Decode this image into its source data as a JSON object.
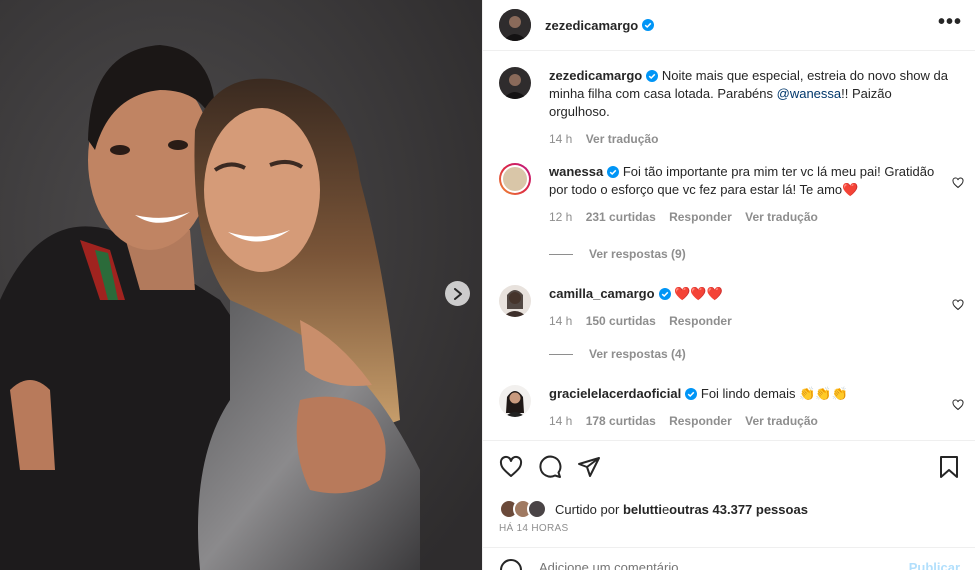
{
  "post": {
    "author": "zezedicamargo",
    "more_label": "•••",
    "caption": {
      "author": "zezedicamargo",
      "text_before": "Noite mais que especial, estreia do novo show da minha filha com casa lotada. Parabéns ",
      "mention": "@wanessa",
      "text_after": "!! Paizão orgulhoso.",
      "time": "14 h",
      "translate": "Ver tradução"
    }
  },
  "comments": [
    {
      "user": "wanessa",
      "text": "Foi tão importante pra mim ter vc lá meu pai! Gratidão por todo o esforço que vc fez para estar lá! Te amo",
      "emoji": "❤️",
      "time": "12 h",
      "likes": "231 curtidas",
      "reply": "Responder",
      "translate": "Ver tradução",
      "view_replies": "Ver respostas (9)"
    },
    {
      "user": "camilla_camargo",
      "text": "",
      "emoji": "❤️❤️❤️",
      "time": "14 h",
      "likes": "150 curtidas",
      "reply": "Responder",
      "view_replies": "Ver respostas (4)"
    },
    {
      "user": "gracielelacerdaoficial",
      "text": "Foi lindo demais",
      "emoji": "👏👏👏",
      "time": "14 h",
      "likes": "178 curtidas",
      "reply": "Responder",
      "translate": "Ver tradução"
    }
  ],
  "likes": {
    "prefix": "Curtido por ",
    "user": "belutti",
    "middle": " e ",
    "others": "outras 43.377 pessoas"
  },
  "timestamp": "HÁ 14 HORAS",
  "add_comment": {
    "placeholder": "Adicione um comentário...",
    "publish": "Publicar"
  },
  "colors": {
    "verified": "#0095f6",
    "heart": "#e0112b",
    "mention": "#00376b",
    "muted": "#8e8e8e"
  }
}
